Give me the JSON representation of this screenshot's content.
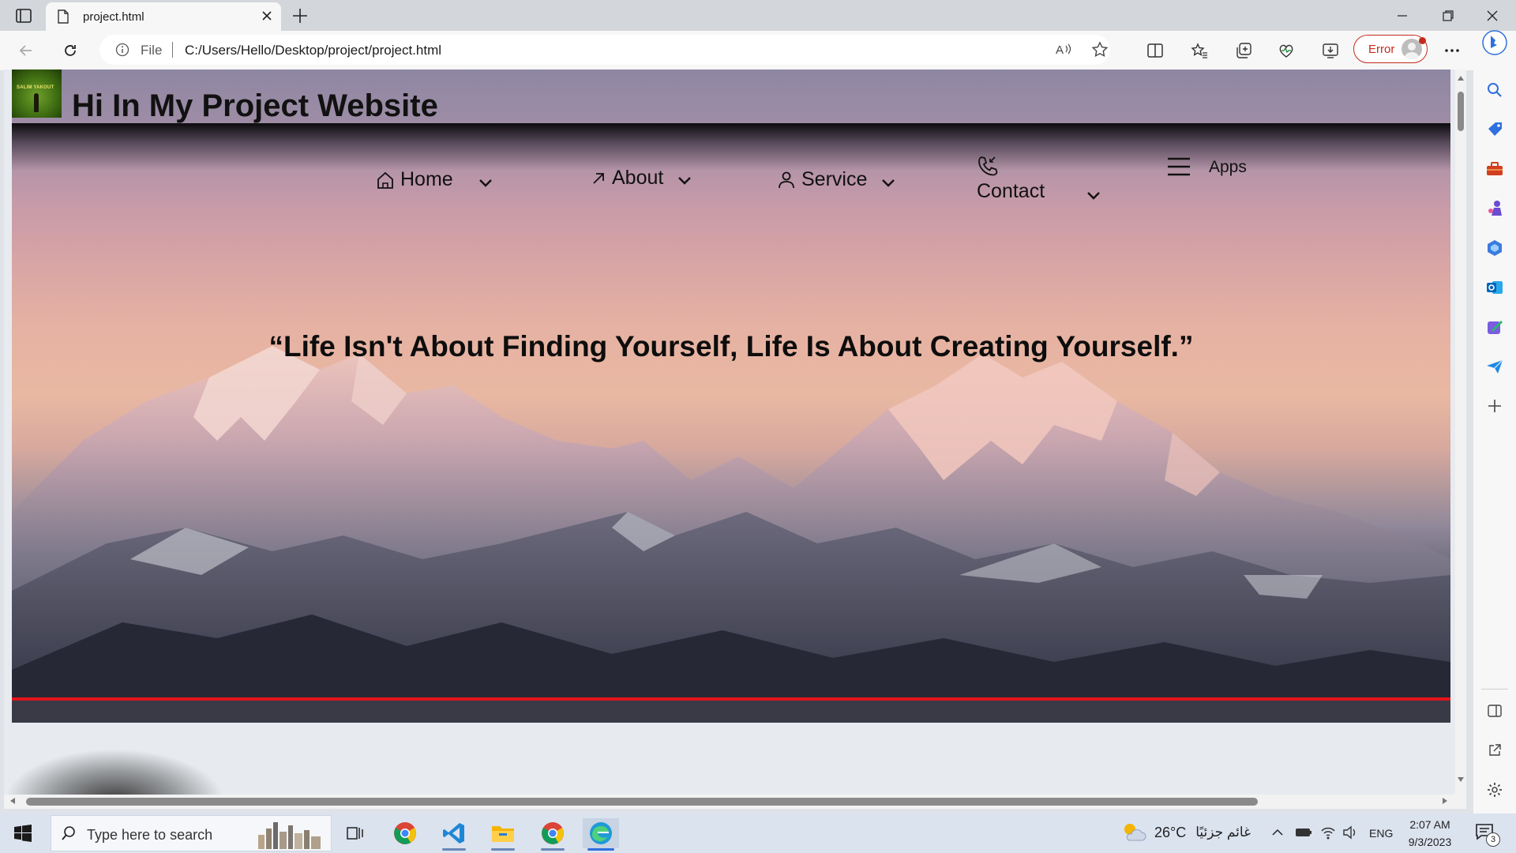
{
  "browser": {
    "tab_title": "project.html",
    "address_scheme_label": "File",
    "address_url": "C:/Users/Hello/Desktop/project/project.html",
    "profile_status": "Error"
  },
  "page": {
    "site_title": "Hi In My Project Website",
    "logo_text": "SALIM YAKOUT",
    "nav": [
      {
        "label": "Home",
        "icon": "home-icon"
      },
      {
        "label": "About",
        "icon": "arrow-up-right-icon"
      },
      {
        "label": "Service",
        "icon": "person-icon"
      },
      {
        "label": "Contact",
        "icon": "phone-icon"
      },
      {
        "label": "Apps",
        "icon": "hamburger-icon"
      }
    ],
    "quote": "“Life Isn't About Finding Yourself, Life Is About Creating Yourself.”",
    "accent_line_color": "#e4141a"
  },
  "taskbar": {
    "search_placeholder": "Type here to search",
    "temperature": "26°C",
    "weather_condition": "غائم جزئيًا",
    "language": "ENG",
    "time": "2:07 AM",
    "date": "9/3/2023",
    "notification_count": "3"
  }
}
